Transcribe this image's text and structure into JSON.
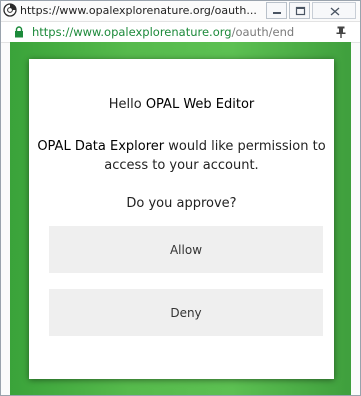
{
  "window": {
    "title": "https://www.opalexplorenature.org/oauth...",
    "browser_icon": "globe-icon"
  },
  "address": {
    "url_host": "https://www.opalexplorenature.org",
    "url_path": "/oauth/end",
    "lock_icon": "lock-icon",
    "pin_icon": "pin-icon"
  },
  "dialog": {
    "hello_prefix": "Hello ",
    "hello_name": "OPAL Web Editor",
    "app_name": "OPAL Data Explorer",
    "message_rest": " would like permission to access to your account.",
    "question": "Do you approve?",
    "allow_label": "Allow",
    "deny_label": "Deny"
  },
  "colors": {
    "background_green": "#56ba4c",
    "url_green": "#1c8a3a"
  }
}
